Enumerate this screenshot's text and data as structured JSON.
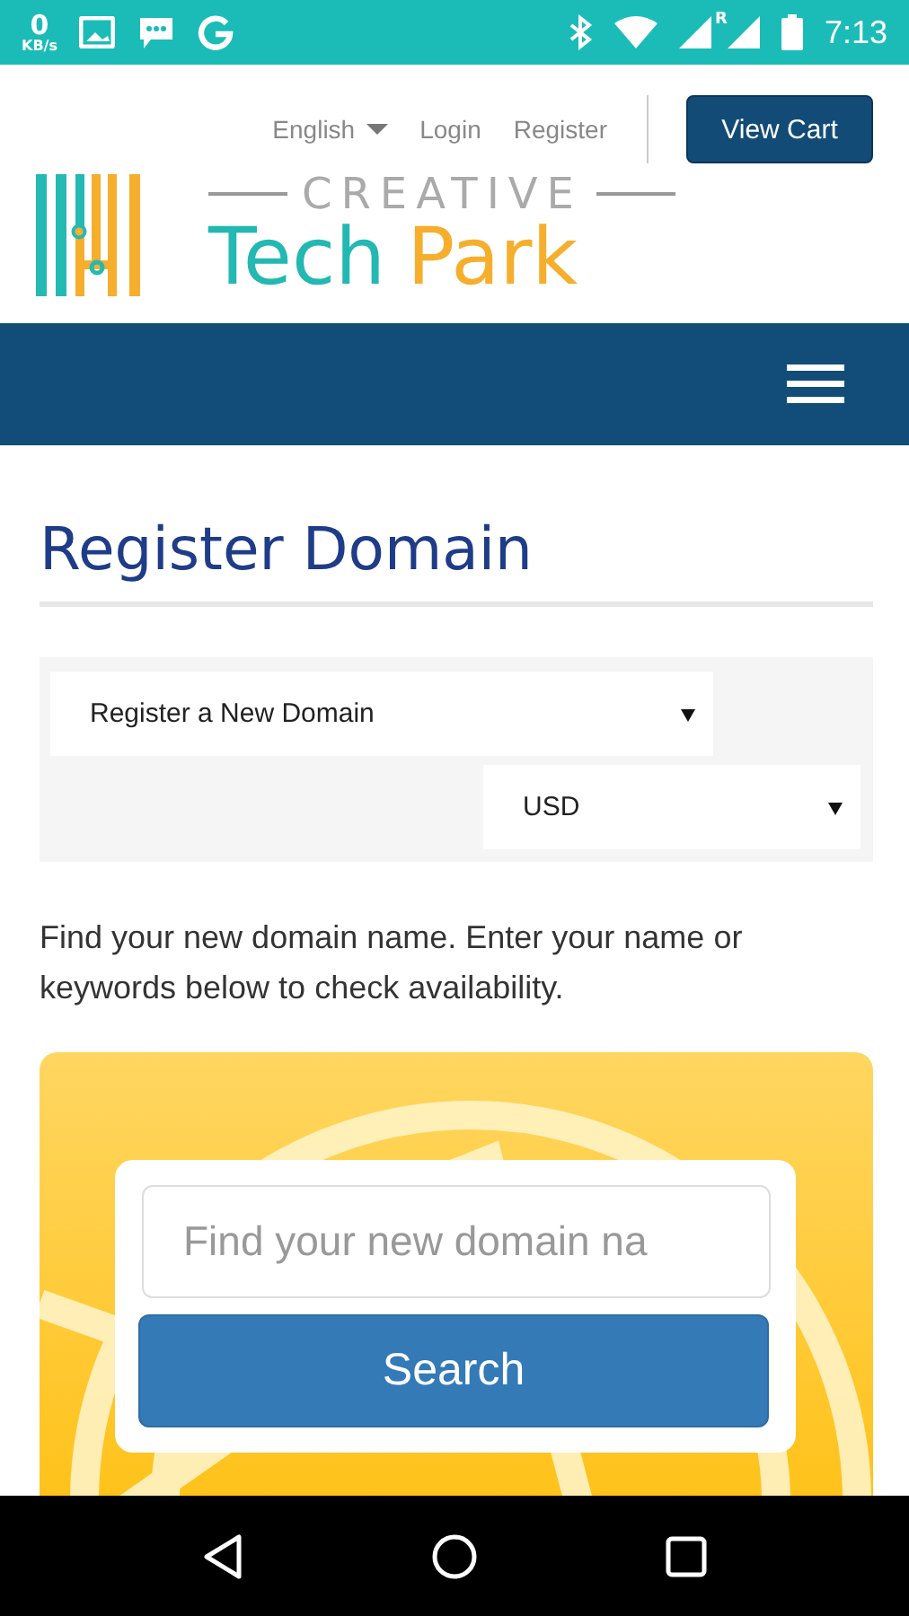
{
  "status_bar": {
    "speed_value": "0",
    "speed_unit": "KB/s",
    "roaming": "R",
    "time": "7:13"
  },
  "header": {
    "language": "English",
    "links": [
      "Login",
      "Register"
    ],
    "cart_button": "View Cart"
  },
  "logo": {
    "tagline": "CREATIVE",
    "name_1": "Tech",
    "name_2": "Park"
  },
  "page": {
    "title": "Register Domain",
    "selects": [
      {
        "value": "Register a New Domain"
      },
      {
        "value": "USD"
      }
    ],
    "intro": "Find your new domain name. Enter your name or keywords below to check availability.",
    "search": {
      "placeholder": "Find your new domain na",
      "button": "Search"
    }
  }
}
